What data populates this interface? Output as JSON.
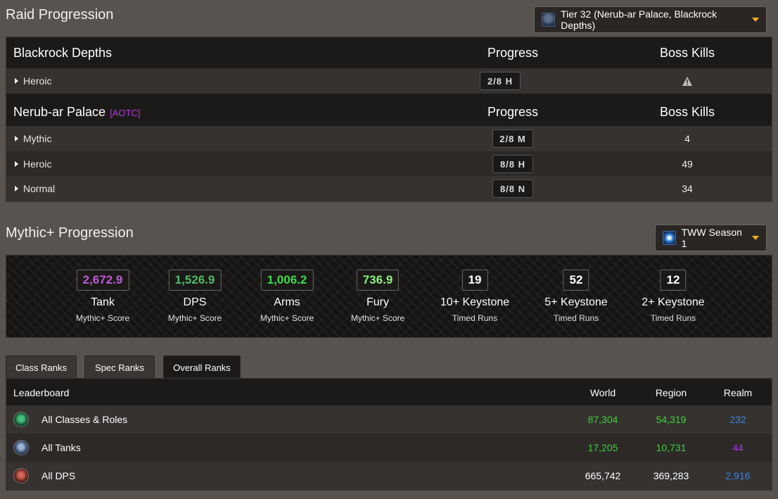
{
  "raid": {
    "title": "Raid Progression",
    "tier_dropdown": "Tier 32 (Nerub-ar Palace, Blackrock Depths)",
    "instances": [
      {
        "name": "Blackrock Depths",
        "tag": "",
        "progress_header": "Progress",
        "kills_header": "Boss Kills",
        "rows": [
          {
            "difficulty": "Heroic",
            "progress": "2/8 H",
            "kills": "",
            "kills_icon": "warning-icon"
          }
        ]
      },
      {
        "name": "Nerub-ar Palace",
        "tag": "[AOTC]",
        "progress_header": "Progress",
        "kills_header": "Boss Kills",
        "rows": [
          {
            "difficulty": "Mythic",
            "progress": "2/8 M",
            "kills": "4"
          },
          {
            "difficulty": "Heroic",
            "progress": "8/8 H",
            "kills": "49"
          },
          {
            "difficulty": "Normal",
            "progress": "8/8 N",
            "kills": "34"
          }
        ]
      }
    ]
  },
  "mplus": {
    "title": "Mythic+ Progression",
    "season_dropdown": "TWW Season 1",
    "scores": [
      {
        "value": "2,672.9",
        "title": "Tank",
        "sub": "Mythic+ Score",
        "color": "#c15ad6"
      },
      {
        "value": "1,526.9",
        "title": "DPS",
        "sub": "Mythic+ Score",
        "color": "#4fba67"
      },
      {
        "value": "1,006.2",
        "title": "Arms",
        "sub": "Mythic+ Score",
        "color": "#3fd94c"
      },
      {
        "value": "736.9",
        "title": "Fury",
        "sub": "Mythic+ Score",
        "color": "#8ff07a"
      },
      {
        "value": "19",
        "title": "10+ Keystone",
        "sub": "Timed Runs",
        "color": "#ffffff"
      },
      {
        "value": "52",
        "title": "5+ Keystone",
        "sub": "Timed Runs",
        "color": "#ffffff"
      },
      {
        "value": "12",
        "title": "2+ Keystone",
        "sub": "Timed Runs",
        "color": "#ffffff"
      }
    ]
  },
  "tabs": [
    "Class Ranks",
    "Spec Ranks",
    "Overall Ranks"
  ],
  "active_tab": "Overall Ranks",
  "leaderboard": {
    "headers": {
      "name": "Leaderboard",
      "world": "World",
      "region": "Region",
      "realm": "Realm"
    },
    "rows": [
      {
        "label": "All Classes & Roles",
        "icon": "all-classes-emblem-icon",
        "world": "87,304",
        "region": "54,319",
        "realm": "232",
        "world_color": "#3dd13a",
        "region_color": "#3dd13a",
        "realm_color": "#3b82e0"
      },
      {
        "label": "All Tanks",
        "icon": "tank-emblem-icon",
        "world": "17,205",
        "region": "10,731",
        "realm": "44",
        "world_color": "#3dd13a",
        "region_color": "#3dd13a",
        "realm_color": "#a335ee"
      },
      {
        "label": "All DPS",
        "icon": "dps-emblem-icon",
        "world": "665,742",
        "region": "369,283",
        "realm": "2,916",
        "world_color": "#ffffff",
        "region_color": "#ffffff",
        "realm_color": "#3b82e0"
      }
    ]
  }
}
